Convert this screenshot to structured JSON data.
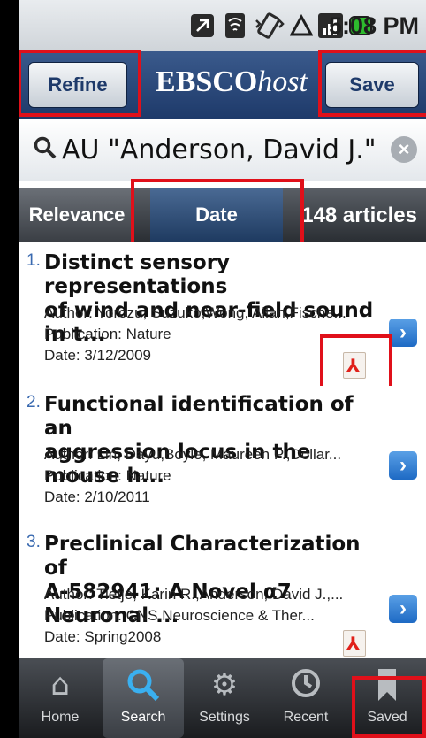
{
  "status_bar": {
    "time": "5:08 PM",
    "icons": [
      "nfc-icon",
      "wifi-icon",
      "vibrate-icon",
      "data-icon",
      "signal-icon",
      "battery-icon"
    ]
  },
  "header": {
    "refine_label": "Refine",
    "brand_bold": "EBSCO",
    "brand_italic": "host",
    "save_label": "Save"
  },
  "search": {
    "query": "AU \"Anderson, David J.\""
  },
  "sort": {
    "relevance_label": "Relevance",
    "date_label": "Date",
    "count_label": "148 articles"
  },
  "results": [
    {
      "number": "1.",
      "title_line1": "Distinct sensory representations",
      "title_line2": "of wind and near-field sound in t...",
      "author": "Author: Yorozu, Suzuko,Wong, Allan,Fische...",
      "publication": "Publication: Nature",
      "date": "Date: 3/12/2009",
      "has_pdf": true
    },
    {
      "number": "2.",
      "title_line1": "Functional identification of an",
      "title_line2": "aggression locus in the mouse h...",
      "author": "Author: Lin, Dayu,Boyle, Maureen P.,Dollar...",
      "publication": "Publication: Nature",
      "date": "Date: 2/10/2011",
      "has_pdf": false
    },
    {
      "number": "3.",
      "title_line1": "Preclinical Characterization of",
      "title_line2": "A-582941: A Novel α7 Neuronal ...",
      "author": "Author: Tietje, Karin R.,Anderson, David J.,...",
      "publication": "Publication: CNS Neuroscience & Ther...",
      "date": "Date: Spring2008",
      "has_pdf": true
    }
  ],
  "nav": {
    "items": [
      {
        "label": "Home",
        "icon": "home-icon"
      },
      {
        "label": "Search",
        "icon": "search-icon"
      },
      {
        "label": "Settings",
        "icon": "gear-icon"
      },
      {
        "label": "Recent",
        "icon": "clock-icon"
      },
      {
        "label": "Saved",
        "icon": "bookmark-icon"
      }
    ],
    "active": "Search"
  },
  "colors": {
    "header": "#1e3a6a",
    "highlight": "#e0101a",
    "accent": "#1e6ac4"
  }
}
